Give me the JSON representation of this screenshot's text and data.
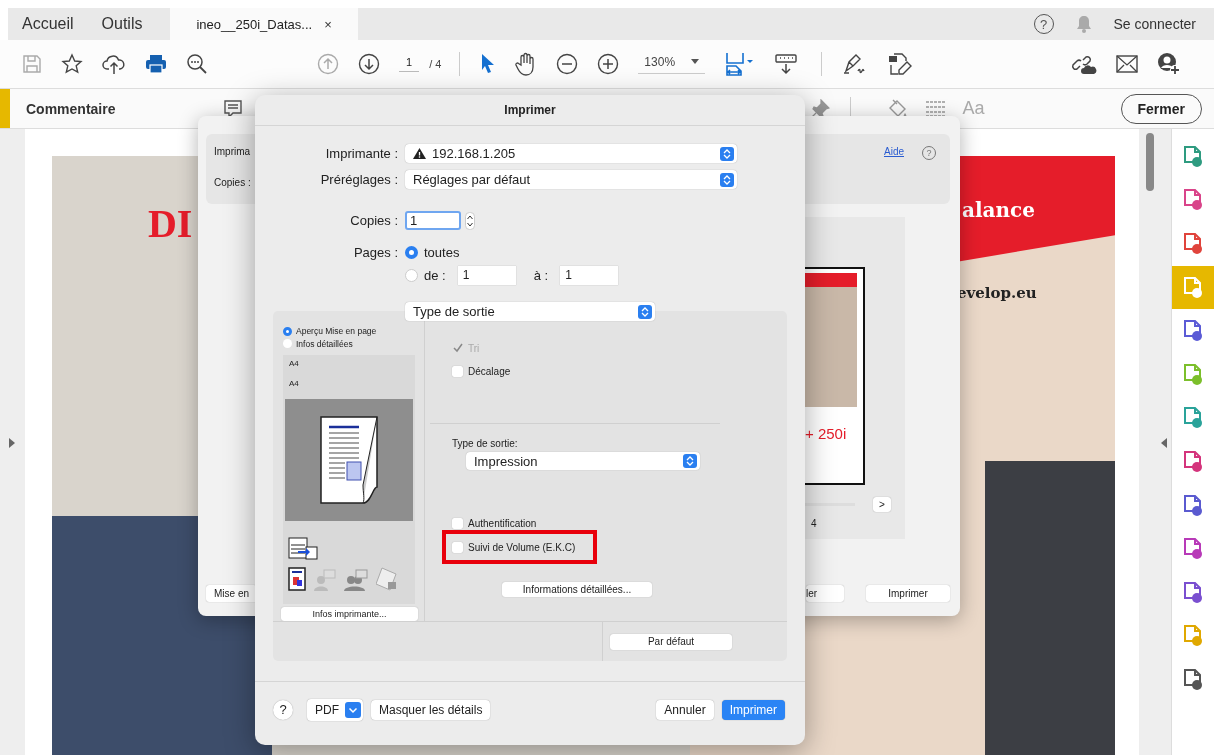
{
  "app_tabs": [
    {
      "label": "Accueil",
      "selected": false
    },
    {
      "label": "Outils",
      "selected": false
    }
  ],
  "document_tab": {
    "title": "ineo__250i_Datas...",
    "close": "×",
    "selected": true
  },
  "account": {
    "help": "?",
    "sign_in": "Se connecter"
  },
  "toolbar": {
    "page_current": "1",
    "page_total": "/ 4",
    "zoom": "130%"
  },
  "comment_bar": {
    "title": "Commentaire",
    "font_label": "Aa",
    "close_button": "Fermer"
  },
  "right_tools": [
    {
      "selected": false,
      "color": "#2e9b80"
    },
    {
      "selected": false,
      "color": "#d9448a"
    },
    {
      "selected": false,
      "color": "#e0443c"
    },
    {
      "selected": true,
      "color": "#ffffff"
    },
    {
      "selected": false,
      "color": "#5b5bd6"
    },
    {
      "selected": false,
      "color": "#7cbf2b"
    },
    {
      "selected": false,
      "color": "#2aa39a"
    },
    {
      "selected": false,
      "color": "#d4347c"
    },
    {
      "selected": false,
      "color": "#5a5ad0"
    },
    {
      "selected": false,
      "color": "#b83ab8"
    },
    {
      "selected": false,
      "color": "#7a4fd0"
    },
    {
      "selected": false,
      "color": "#e0a800"
    },
    {
      "selected": false,
      "color": "#555555"
    }
  ],
  "document": {
    "red_text": "DI",
    "banner_text": "alance",
    "url_text": "evelop.eu"
  },
  "back_dialog": {
    "printer_label": "Imprima",
    "copies_label": "Copies :",
    "help_link": "Aide",
    "help": "?",
    "thumbnail_text": "+ 250i",
    "next_button": ">",
    "page_count": "4",
    "left_button": "Mise en",
    "cancel_button": "ler",
    "print_button": "Imprimer"
  },
  "print_sheet": {
    "title": "Imprimer",
    "printer": {
      "label": "Imprimante :",
      "value": "192.168.1.205",
      "warning": true
    },
    "presets": {
      "label": "Préréglages :",
      "value": "Réglages par défaut"
    },
    "copies": {
      "label": "Copies :",
      "value": "1"
    },
    "pages": {
      "label": "Pages :",
      "options": [
        {
          "label": "toutes",
          "selected": true
        },
        {
          "label": "de :",
          "selected": false
        }
      ],
      "from": "1",
      "to_label": "à :",
      "to": "1"
    },
    "section_popup": "Type de sortie",
    "preview_modes": [
      {
        "label": "Aperçu Mise en page",
        "selected": true
      },
      {
        "label": "Infos détaillées",
        "selected": false
      }
    ],
    "paper_sizes": [
      "A4",
      "A4"
    ],
    "printer_info_button": "Infos imprimante...",
    "finishing": [
      {
        "label": "Tri",
        "checked": true,
        "disabled": true
      },
      {
        "label": "Décalage",
        "checked": false,
        "disabled": false
      }
    ],
    "output_type": {
      "label": "Type de sortie:",
      "value": "Impression"
    },
    "options": [
      {
        "label": "Authentification",
        "checked": false,
        "highlighted": false
      },
      {
        "label": "Suivi de Volume (E.K.C)",
        "checked": false,
        "highlighted": true
      }
    ],
    "details_button": "Informations détaillées...",
    "default_button": "Par défaut",
    "footer": {
      "help": "?",
      "pdf": "PDF",
      "hide_details": "Masquer les détails",
      "cancel": "Annuler",
      "print": "Imprimer"
    }
  }
}
